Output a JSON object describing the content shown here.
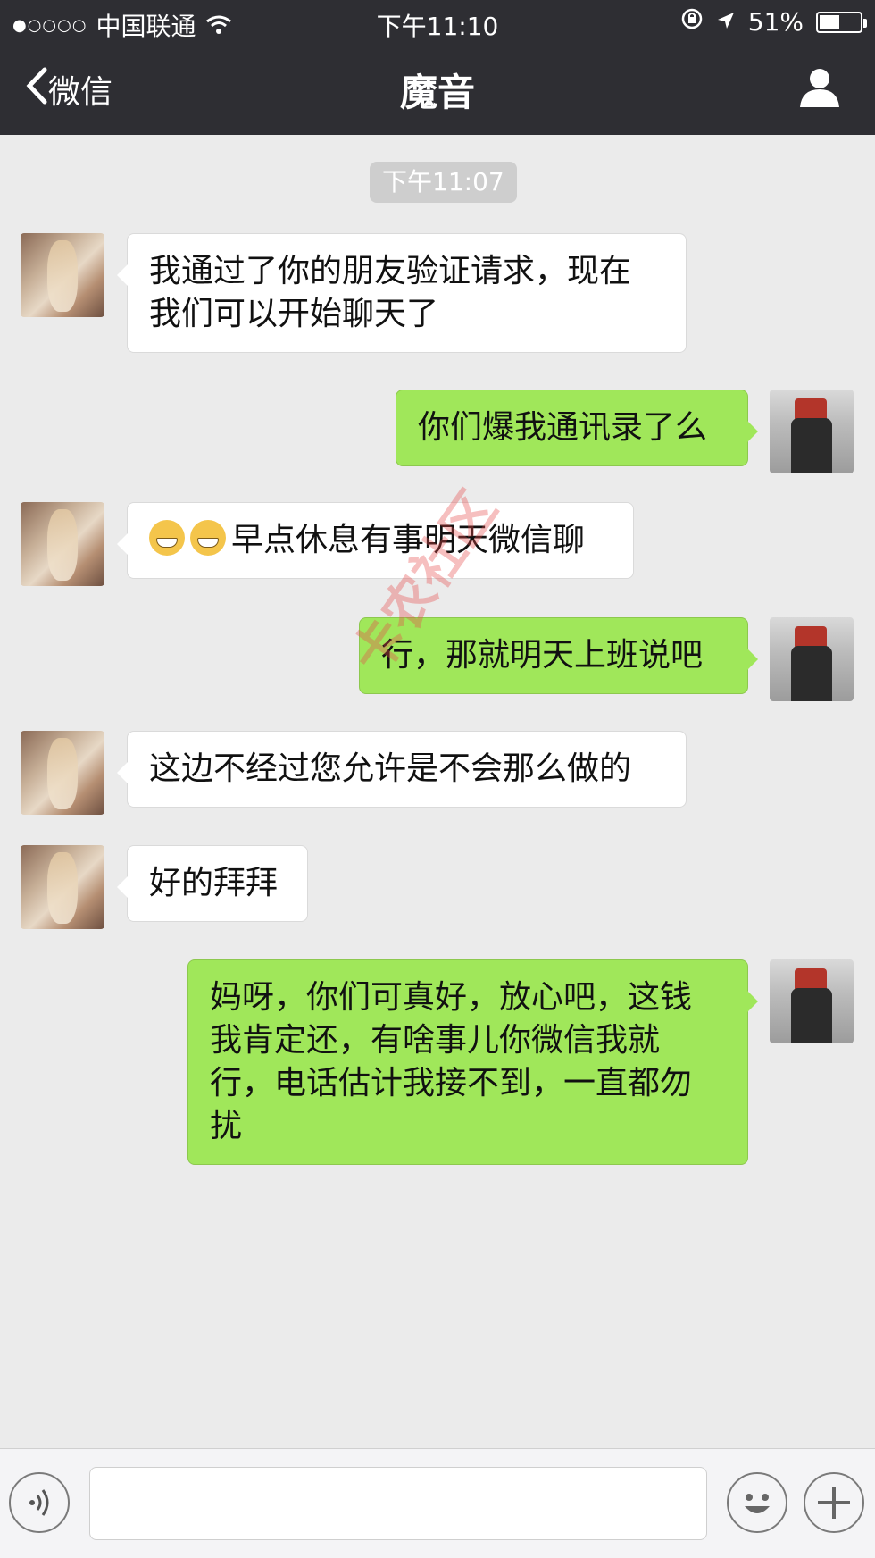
{
  "status_bar": {
    "signal": "●○○○○",
    "carrier": "中国联通",
    "time": "下午11:10",
    "battery_text": "51%",
    "battery_level": 0.51
  },
  "nav": {
    "back_label": "微信",
    "title": "魔音"
  },
  "chat": {
    "timestamp": "下午11:07",
    "messages": [
      {
        "from": "her",
        "lines": [
          "我通过了你的朋友验证请求，现在",
          "我们可以开始聊天了"
        ]
      },
      {
        "from": "me",
        "lines": [
          "你们爆我通讯录了么"
        ]
      },
      {
        "from": "her",
        "emoji_count": 2,
        "emoji_name": "grinning-emoji",
        "lines": [
          "早点休息有事明天微信聊"
        ]
      },
      {
        "from": "me",
        "lines": [
          "行，那就明天上班说吧"
        ]
      },
      {
        "from": "her",
        "lines": [
          "这边不经过您允许是不会那么做的"
        ]
      },
      {
        "from": "her",
        "lines": [
          "好的拜拜"
        ]
      },
      {
        "from": "me",
        "lines": [
          "妈呀，你们可真好，放心吧，这钱",
          "我肯定还，有啥事儿你微信我就",
          "行，电话估计我接不到，一直都勿",
          "扰"
        ]
      }
    ]
  },
  "watermark": "卡农社区",
  "input_bar": {
    "placeholder": ""
  },
  "colors": {
    "nav_bg": "#2e2e33",
    "chat_bg": "#ebebeb",
    "incoming_bubble": "#ffffff",
    "outgoing_bubble": "#a0e75a"
  }
}
